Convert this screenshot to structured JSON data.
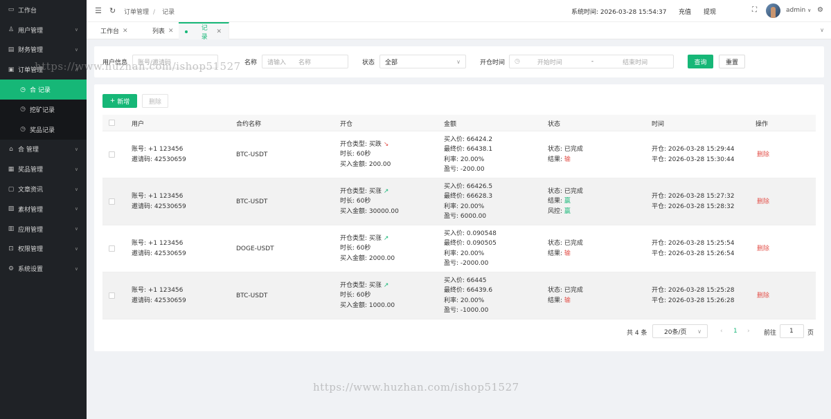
{
  "sidebar": {
    "items": [
      {
        "icon": "monitor-icon",
        "label": "工作台",
        "chev": ""
      },
      {
        "icon": "user-icon",
        "label": "用户管理",
        "chev": "v"
      },
      {
        "icon": "finance-icon",
        "label": "财务管理",
        "chev": "v"
      },
      {
        "icon": "order-icon",
        "label": "订单管理",
        "chev": "^"
      },
      {
        "icon": "clock-icon",
        "label": "合   记录",
        "chev": "",
        "sub": true,
        "active": true
      },
      {
        "icon": "clock-icon",
        "label": "挖矿记录",
        "chev": "",
        "sub": true
      },
      {
        "icon": "clock-icon",
        "label": "奖品记录",
        "chev": "",
        "sub": true
      },
      {
        "icon": "contract-icon",
        "label": "合    管理",
        "chev": "v"
      },
      {
        "icon": "gift-icon",
        "label": "奖品管理",
        "chev": "v"
      },
      {
        "icon": "article-icon",
        "label": "文章资讯",
        "chev": "v"
      },
      {
        "icon": "image-icon",
        "label": "素材管理",
        "chev": "v"
      },
      {
        "icon": "app-icon",
        "label": "应用管理",
        "chev": "v"
      },
      {
        "icon": "lock-icon",
        "label": "权限管理",
        "chev": "v"
      },
      {
        "icon": "gear-icon",
        "label": "系统设置",
        "chev": "v"
      }
    ]
  },
  "header": {
    "breadcrumb_parent": "订单管理",
    "breadcrumb_sep": "/",
    "breadcrumb_current": "记录",
    "system_time": "系统时间: 2026-03-28 15:54:37",
    "recharge": "充值",
    "withdraw": "提现",
    "user": "admin"
  },
  "tabs": [
    {
      "label": "工作台"
    },
    {
      "label": "列表"
    },
    {
      "label": "记录",
      "active": true
    }
  ],
  "filter": {
    "user_info_label": "用户信息",
    "user_info_placeholder": "账号/邀请码",
    "name_label": "名称",
    "name_placeholder_a": "请输入",
    "name_placeholder_b": "名称",
    "status_label": "状态",
    "status_value": "全部",
    "open_time_label": "开仓时间",
    "start_placeholder": "开始时间",
    "range_sep": "-",
    "end_placeholder": "结束时间",
    "search_label": "查询",
    "reset_label": "重置"
  },
  "toolbar": {
    "add_label": "新增",
    "delete_label": "删除"
  },
  "table": {
    "headers": [
      "用户",
      "合约名称",
      "开仓",
      "金额",
      "状态",
      "时间",
      "操作"
    ],
    "rows": [
      {
        "account": "账号: +1 123456",
        "invite": "邀请码: 42530659",
        "contract": "BTC-USDT",
        "open_type": "开仓类型: 买跌",
        "direction": "down",
        "duration": "时长: 60秒",
        "buy_amount": "买入金额: 200.00",
        "buy_price": "买入价: 66424.2",
        "final_price": "最终价: 66438.1",
        "rate": "利率: 20.00%",
        "pnl": "盈亏: -200.00",
        "status_label": "状态: ",
        "status_value": "已完成",
        "result_label": "结果: ",
        "result_value": "输",
        "result_color": "red",
        "risk_label": "",
        "risk_value": "",
        "open_time": "开仓: 2026-03-28 15:29:44",
        "close_time": "平仓: 2026-03-28 15:30:44",
        "action": "删除"
      },
      {
        "account": "账号: +1 123456",
        "invite": "邀请码: 42530659",
        "contract": "BTC-USDT",
        "open_type": "开仓类型: 买涨",
        "direction": "up",
        "duration": "时长: 60秒",
        "buy_amount": "买入金额: 30000.00",
        "buy_price": "买入价: 66426.5",
        "final_price": "最终价: 66628.3",
        "rate": "利率: 20.00%",
        "pnl": "盈亏: 6000.00",
        "status_label": "状态: ",
        "status_value": "已完成",
        "result_label": "结果: ",
        "result_value": "赢",
        "result_color": "green",
        "risk_label": "风控: ",
        "risk_value": "赢",
        "open_time": "开仓: 2026-03-28 15:27:32",
        "close_time": "平仓: 2026-03-28 15:28:32",
        "action": "删除"
      },
      {
        "account": "账号: +1 123456",
        "invite": "邀请码: 42530659",
        "contract": "DOGE-USDT",
        "open_type": "开仓类型: 买涨",
        "direction": "up",
        "duration": "时长: 60秒",
        "buy_amount": "买入金额: 2000.00",
        "buy_price": "买入价: 0.090548",
        "final_price": "最终价: 0.090505",
        "rate": "利率: 20.00%",
        "pnl": "盈亏: -2000.00",
        "status_label": "状态: ",
        "status_value": "已完成",
        "result_label": "结果: ",
        "result_value": "输",
        "result_color": "red",
        "risk_label": "",
        "risk_value": "",
        "open_time": "开仓: 2026-03-28 15:25:54",
        "close_time": "平仓: 2026-03-28 15:26:54",
        "action": "删除"
      },
      {
        "account": "账号: +1 123456",
        "invite": "邀请码: 42530659",
        "contract": "BTC-USDT",
        "open_type": "开仓类型: 买涨",
        "direction": "up",
        "duration": "时长: 60秒",
        "buy_amount": "买入金额: 1000.00",
        "buy_price": "买入价: 66445",
        "final_price": "最终价: 66439.6",
        "rate": "利率: 20.00%",
        "pnl": "盈亏: -1000.00",
        "status_label": "状态: ",
        "status_value": "已完成",
        "result_label": "结果: ",
        "result_value": "输",
        "result_color": "red",
        "risk_label": "",
        "risk_value": "",
        "open_time": "开仓: 2026-03-28 15:25:28",
        "close_time": "平仓: 2026-03-28 15:26:28",
        "action": "删除"
      }
    ]
  },
  "pagination": {
    "total": "共 4 条",
    "page_size": "20条/页",
    "current_page": "1",
    "goto_label": "前往",
    "goto_value": "1",
    "page_suffix": "页"
  },
  "watermark": {
    "text": "https://www.huzhan.com/ishop51527"
  },
  "colors": {
    "accent": "#16b777",
    "sidebar_bg": "#1f2226",
    "danger": "#e3534c"
  }
}
